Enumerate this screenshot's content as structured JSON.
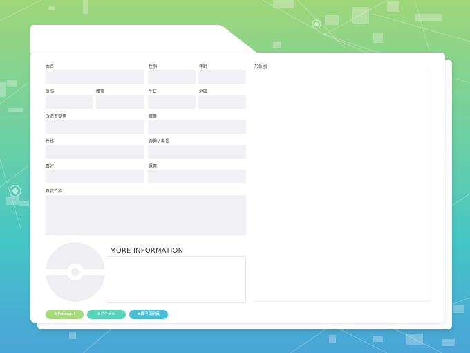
{
  "fields": {
    "real_name": "本名",
    "gender": "性別",
    "age": "年齡",
    "image": "形象圖",
    "height": "身高",
    "weight": "體重",
    "birthday": "生日",
    "region": "地區",
    "modification": "改造百變怪",
    "occupation": "職業",
    "personality": "性格",
    "hobby": "興趣 / 專長",
    "likes": "喜好",
    "dislikes": "厭惡",
    "self_intro": "自我介紹"
  },
  "more_information": {
    "title": "MORE INFORMATION"
  },
  "tags": [
    {
      "label": "#Pokenavi",
      "color": "#a6db7e"
    },
    {
      "label": "#ポケナビ",
      "color": "#57d3b8"
    },
    {
      "label": "#寶可領航員",
      "color": "#47c0d6"
    }
  ],
  "colors": {
    "bg_top": "#9fd67a",
    "bg_bottom": "#4aa4d8",
    "field": "#f1f1f5",
    "card": "#ffffff"
  },
  "icons": {
    "avatar": "pokeball-icon"
  }
}
